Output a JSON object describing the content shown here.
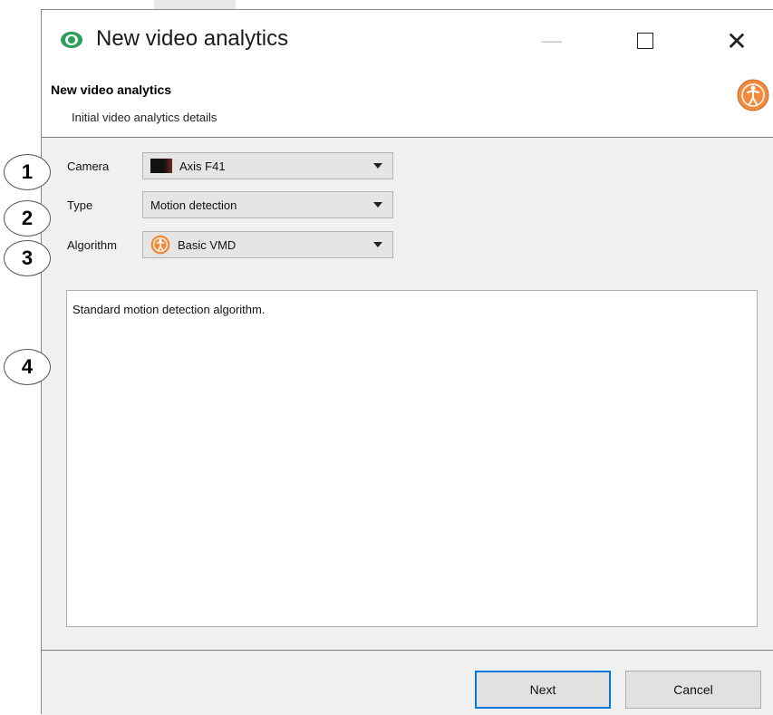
{
  "window": {
    "title": "New video analytics",
    "controls": {
      "minimize": "—",
      "maximize": "□",
      "close": "✕"
    }
  },
  "header": {
    "title": "New video analytics",
    "subtitle": "Initial video analytics details",
    "icon": "person-motion-icon"
  },
  "form": {
    "camera": {
      "label": "Camera",
      "value": "Axis F41"
    },
    "type": {
      "label": "Type",
      "value": "Motion detection"
    },
    "algorithm": {
      "label": "Algorithm",
      "value": "Basic VMD"
    }
  },
  "description": "Standard motion detection algorithm.",
  "buttons": {
    "next": "Next",
    "cancel": "Cancel"
  },
  "callouts": [
    "1",
    "2",
    "3",
    "4"
  ],
  "colors": {
    "accent": "#0078d7",
    "app_icon_green": "#2e9e5b",
    "algorithm_icon_orange": "#f08a3c"
  }
}
